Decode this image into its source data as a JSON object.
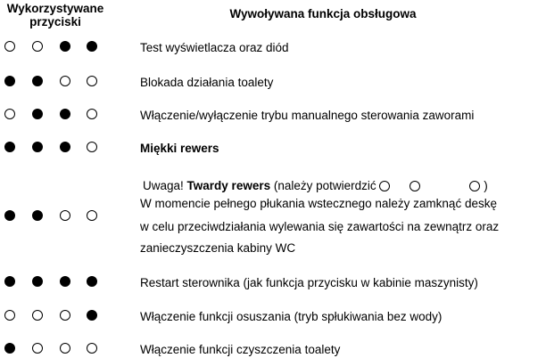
{
  "header": {
    "buttons": "Wykorzystywane przyciski",
    "function": "Wywoływana funkcja obsługowa"
  },
  "rows": [
    {
      "dots": [
        false,
        false,
        true,
        true
      ],
      "text": "Test wyświetlacza oraz diód"
    },
    {
      "dots": [
        true,
        true,
        false,
        false
      ],
      "text": "Blokada działania toalety"
    },
    {
      "dots": [
        false,
        true,
        true,
        false
      ],
      "text": "Włączenie/wyłączenie trybu manualnego sterowania zaworami"
    },
    {
      "dots": [
        true,
        true,
        true,
        false
      ],
      "text": "Miękki rewers"
    },
    {
      "dots": [
        true,
        true,
        false,
        false
      ],
      "intro": "Uwaga!",
      "bold": "Twardy rewers",
      "rest": "(należy potwierdzić",
      "close": ")",
      "lines": [
        "W momencie pełnego płukania wstecznego należy zamknąć deskę",
        "w celu przeciwdziałania wylewania się zawartości na zewnątrz oraz",
        "zanieczyszczenia kabiny WC"
      ]
    },
    {
      "dots": [
        true,
        true,
        true,
        true
      ],
      "text": "Restart sterownika (jak funkcja przycisku w kabinie maszynisty)"
    },
    {
      "dots": [
        false,
        false,
        false,
        true
      ],
      "text": "Włączenie funkcji osuszania (tryb spłukiwania bez wody)"
    },
    {
      "dots": [
        true,
        false,
        false,
        false
      ],
      "text": "Włączenie funkcji czyszczenia toalety"
    }
  ]
}
